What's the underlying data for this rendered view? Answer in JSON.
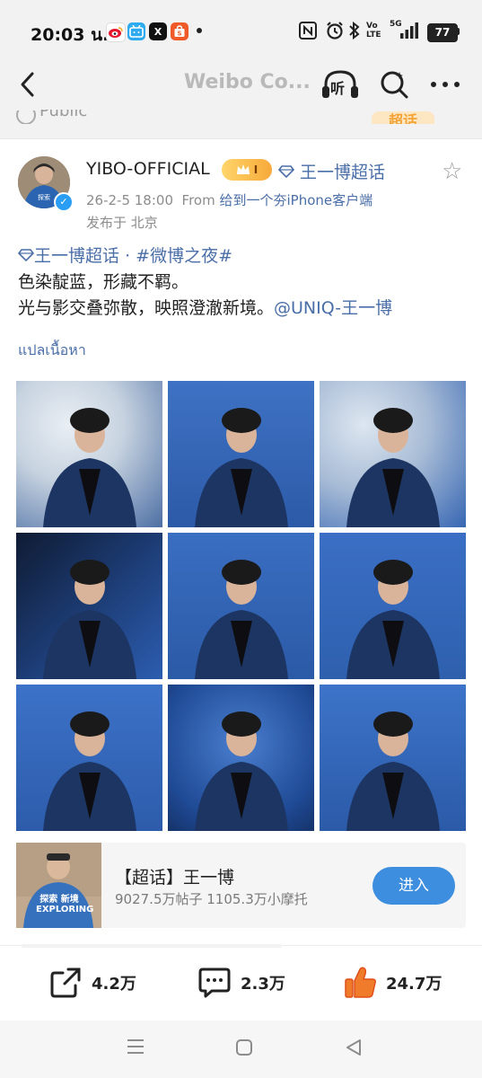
{
  "status_bar": {
    "time": "20:03 น.",
    "battery": "77",
    "icons": [
      "weibo-app-icon",
      "bilibili-app-icon",
      "x-app-icon",
      "shopee-app-icon",
      "dot-icon",
      "nfc-icon",
      "alarm-icon",
      "bluetooth-icon",
      "volte-icon",
      "signal-5g-icon",
      "battery-icon"
    ],
    "volte_label": "Vo LTE",
    "network_label": "5G"
  },
  "nav": {
    "title": "Weibo Co...",
    "listen_label": "听",
    "icons": [
      "back-chevron-icon",
      "listen-headphones-icon",
      "search-icon",
      "more-icon"
    ]
  },
  "public_label": "Public",
  "supertopic_sticker": "超话",
  "post": {
    "username": "YIBO-OFFICIAL",
    "vip_badge": "I",
    "topic_link": "王一博超话",
    "meta_time": "26-2-5 18:00",
    "meta_from": "From",
    "meta_source": "给到一个夯iPhone客户端",
    "location": "发布于 北京",
    "content": {
      "topic": "王一博超话",
      "separator": "·",
      "hashtag": "#微博之夜#",
      "line1": "色染靛蓝，形藏不羁。",
      "line2": "光与影交叠弥散，映照澄澈新境。",
      "mention": "@UNIQ-王一博"
    },
    "translate": "แปลเนื้อหา",
    "photo_count": 9
  },
  "supertopic_card": {
    "title": "【超话】王一博",
    "stats": "9027.5万帖子 1105.3万小摩托",
    "button": "进入",
    "thumb_text": "探索 新境 EXPLORING"
  },
  "actions": {
    "repost": "4.2万",
    "comment": "2.3万",
    "like": "24.7万"
  },
  "colors": {
    "link": "#4a6ea8",
    "button": "#3e8ee0",
    "like": "#f07b2a",
    "photo_blue": "#2f5ea8"
  }
}
